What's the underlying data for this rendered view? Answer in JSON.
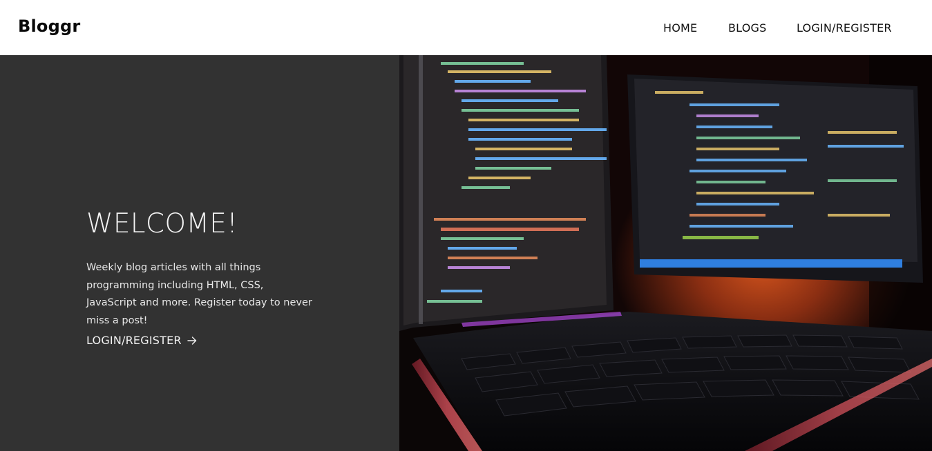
{
  "brand": {
    "name": "Bloggr"
  },
  "nav": {
    "items": [
      {
        "label": "HOME"
      },
      {
        "label": "BLOGS"
      },
      {
        "label": "LOGIN/REGISTER"
      }
    ]
  },
  "hero": {
    "title": "WELCOME!",
    "description": "Weekly blog articles with all things programming including HTML, CSS, JavaScript and more. Register today to never miss a post!",
    "cta_label": "LOGIN/REGISTER",
    "cta_icon": "arrow-right-icon",
    "image": "monitors-with-code-and-keyboard"
  },
  "colors": {
    "hero_left_bg": "#323232",
    "navbar_bg": "#ffffff",
    "text_dark": "#111111",
    "text_light": "#f3f3f3"
  }
}
